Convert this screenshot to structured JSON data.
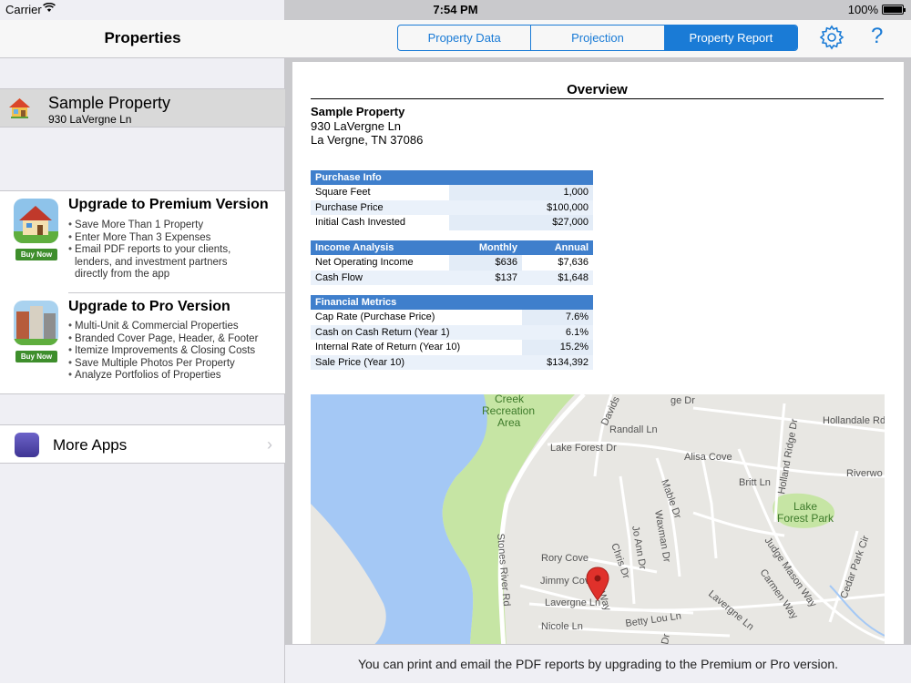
{
  "status_bar": {
    "carrier": "Carrier",
    "time": "7:54 PM",
    "battery": "100%"
  },
  "sidebar": {
    "title": "Properties",
    "property": {
      "name": "Sample Property",
      "address": "930 LaVergne Ln"
    },
    "upgrades": [
      {
        "title": "Upgrade to Premium Version",
        "buy": "Buy Now",
        "features": [
          "Save More Than 1 Property",
          "Enter More Than 3 Expenses",
          "Email PDF reports to your clients, lenders, and investment partners directly from the app"
        ]
      },
      {
        "title": "Upgrade to Pro Version",
        "buy": "Buy Now",
        "features": [
          "Multi-Unit & Commercial Properties",
          "Branded Cover Page, Header, & Footer",
          "Itemize Improvements & Closing Costs",
          "Save Multiple Photos Per Property",
          "Analyze Portfolios of Properties"
        ]
      }
    ],
    "more_apps": "More Apps"
  },
  "header": {
    "tabs": [
      "Property Data",
      "Projection",
      "Property Report"
    ],
    "active_tab": "Property Report",
    "help": "?"
  },
  "report": {
    "title": "Overview",
    "property_name": "Sample Property",
    "address_line1": "930 LaVergne Ln",
    "address_line2": "La Vergne, TN 37086",
    "purchase_info": {
      "header": "Purchase Info",
      "rows": [
        [
          "Square Feet",
          "1,000"
        ],
        [
          "Purchase Price",
          "$100,000"
        ],
        [
          "Initial Cash Invested",
          "$27,000"
        ]
      ]
    },
    "income_analysis": {
      "header": "Income Analysis",
      "col_monthly": "Monthly",
      "col_annual": "Annual",
      "rows": [
        [
          "Net Operating Income",
          "$636",
          "$7,636"
        ],
        [
          "Cash Flow",
          "$137",
          "$1,648"
        ]
      ]
    },
    "financial_metrics": {
      "header": "Financial Metrics",
      "rows": [
        [
          "Cap Rate (Purchase Price)",
          "7.6%"
        ],
        [
          "Cash on Cash Return (Year 1)",
          "6.1%"
        ],
        [
          "Internal Rate of Return (Year 10)",
          "15.2%"
        ],
        [
          "Sale Price (Year 10)",
          "$134,392"
        ]
      ]
    },
    "map_labels": {
      "creek": "Creek",
      "recreation": "Recreation",
      "area": "Area",
      "davids": "Davids",
      "randall": "Randall Ln",
      "hollandale": "Hollandale Rd",
      "lake_forest_dr": "Lake Forest Dr",
      "alisa": "Alisa Cove",
      "britt": "Britt Ln",
      "holland_ridge": "Holland Ridge Dr",
      "riverwood": "Riverwo",
      "lake": "Lake",
      "forest_park": "Forest Park",
      "mable": "Mable Dr",
      "waxman": "Waxman Dr",
      "jo_ann": "Jo Ann Dr",
      "chris": "Chris Dr",
      "stones_river": "Stones River Rd",
      "rory": "Rory Cove",
      "jimmy": "Jimmy Cove",
      "lavergne_ln": "Lavergne Ln",
      "lavergne_ln2": "Lavergne Ln",
      "betty": "Betty Lou Ln",
      "nicole": "Nicole Ln",
      "judge_mason": "Judge Mason Way",
      "carmen": "Carmen Way",
      "cedar_park": "Cedar Park Cir",
      "ge_dr": "ge Dr",
      "dr": "Dr",
      "way": "s Way"
    }
  },
  "footer_message": "You can print and email the PDF reports by upgrading to the Premium or Pro version."
}
